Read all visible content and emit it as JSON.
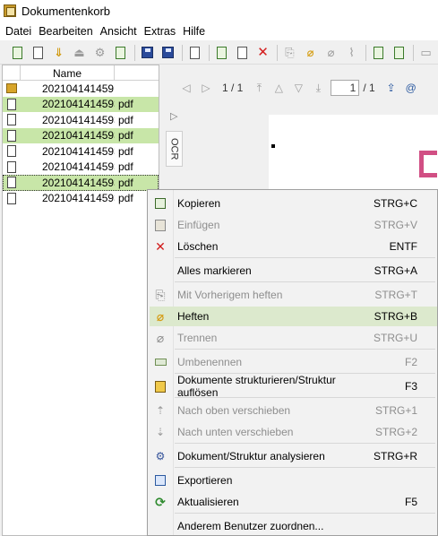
{
  "window": {
    "title": "Dokumentenkorb"
  },
  "menubar": [
    "Datei",
    "Bearbeiten",
    "Ansicht",
    "Extras",
    "Hilfe"
  ],
  "filelist": {
    "column_name": "Name",
    "rows": [
      {
        "name": "202104141459…",
        "ext": "",
        "type": "folder",
        "selected": false
      },
      {
        "name": "2021041414593…",
        "ext": "pdf",
        "type": "doc",
        "selected": true
      },
      {
        "name": "2021041414593…",
        "ext": "pdf",
        "type": "doc",
        "selected": false
      },
      {
        "name": "2021041414593…",
        "ext": "pdf",
        "type": "doc",
        "selected": true
      },
      {
        "name": "2021041414593…",
        "ext": "pdf",
        "type": "doc",
        "selected": false
      },
      {
        "name": "2021041414593…",
        "ext": "pdf",
        "type": "doc",
        "selected": false
      },
      {
        "name": "2021041414593…",
        "ext": "pdf",
        "type": "doc",
        "selected": true
      },
      {
        "name": "2021041414593…",
        "ext": "pdf",
        "type": "doc",
        "selected": false
      }
    ]
  },
  "viewer": {
    "page_indicator": "1 / 1",
    "page_input": "1",
    "page_total": "/ 1",
    "ocr_tab": "OCR"
  },
  "context_menu": {
    "items": [
      {
        "label": "Kopieren",
        "shortcut": "STRG+C",
        "icon": "copy-icon",
        "disabled": false,
        "highlight": false
      },
      {
        "label": "Einfügen",
        "shortcut": "STRG+V",
        "icon": "paste-icon",
        "disabled": true,
        "highlight": false
      },
      {
        "label": "Löschen",
        "shortcut": "ENTF",
        "icon": "delete-icon",
        "disabled": false,
        "highlight": false
      },
      {
        "label": "Alles markieren",
        "shortcut": "STRG+A",
        "icon": "",
        "disabled": false,
        "highlight": false
      },
      {
        "label": "Mit Vorherigem heften",
        "shortcut": "STRG+T",
        "icon": "attach-previous-icon",
        "disabled": true,
        "highlight": false
      },
      {
        "label": "Heften",
        "shortcut": "STRG+B",
        "icon": "paperclip-icon",
        "disabled": false,
        "highlight": true
      },
      {
        "label": "Trennen",
        "shortcut": "STRG+U",
        "icon": "detach-icon",
        "disabled": true,
        "highlight": false
      },
      {
        "label": "Umbenennen",
        "shortcut": "F2",
        "icon": "rename-icon",
        "disabled": true,
        "highlight": false
      },
      {
        "label": "Dokumente strukturieren/Struktur auflösen",
        "shortcut": "F3",
        "icon": "structure-icon",
        "disabled": false,
        "highlight": false
      },
      {
        "label": "Nach oben verschieben",
        "shortcut": "STRG+1",
        "icon": "move-up-icon",
        "disabled": true,
        "highlight": false
      },
      {
        "label": "Nach unten verschieben",
        "shortcut": "STRG+2",
        "icon": "move-down-icon",
        "disabled": true,
        "highlight": false
      },
      {
        "label": "Dokument/Struktur analysieren",
        "shortcut": "STRG+R",
        "icon": "analyze-icon",
        "disabled": false,
        "highlight": false
      },
      {
        "label": "Exportieren",
        "shortcut": "",
        "icon": "export-icon",
        "disabled": false,
        "highlight": false
      },
      {
        "label": "Aktualisieren",
        "shortcut": "F5",
        "icon": "refresh-icon",
        "disabled": false,
        "highlight": false
      },
      {
        "label": "Anderem Benutzer zuordnen...",
        "shortcut": "",
        "icon": "",
        "disabled": false,
        "highlight": false
      }
    ]
  },
  "colors": {
    "selection": "#c8e6a8",
    "menu_highlight": "#dce9cd",
    "delete_red": "#d11b1b",
    "clip_gold": "#d59c15"
  }
}
